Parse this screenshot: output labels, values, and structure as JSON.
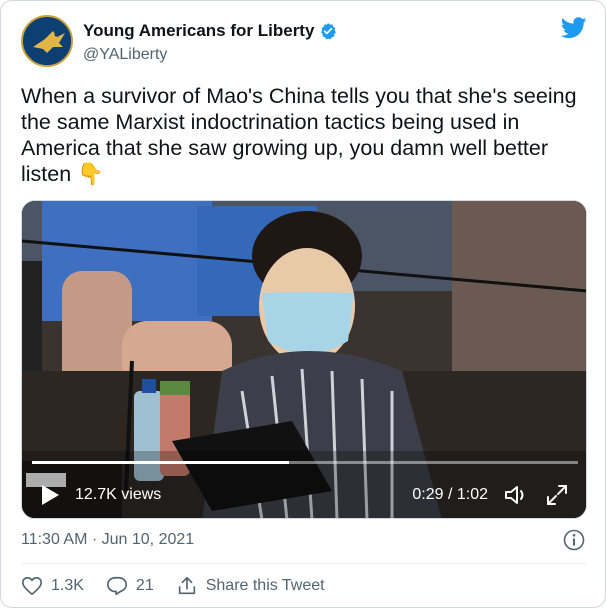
{
  "author": {
    "name": "Young Americans for Liberty",
    "handle": "@YALiberty",
    "avatar_icon": "eagle-logo-icon",
    "verified_icon": "verified-badge-icon"
  },
  "platform_icon": "twitter-bird-icon",
  "tweet": {
    "text": "When a survivor of Mao's China tells you that she's seeing the same Marxist indoctrination tactics being used in America that she saw growing up, you damn well better listen",
    "emoji": "👇"
  },
  "video": {
    "views": "12.7K views",
    "time": "0:29 / 1:02",
    "progress": 0.47,
    "controls": [
      "play-icon",
      "volume-icon",
      "fullscreen-icon"
    ]
  },
  "timestamp": "11:30 AM · Jun 10, 2021",
  "actions": {
    "likes": "1.3K",
    "replies": "21",
    "share_label": "Share this Tweet"
  },
  "colors": {
    "brand": "#1d9bf0",
    "text": "#0f1419",
    "muted": "#536471"
  }
}
